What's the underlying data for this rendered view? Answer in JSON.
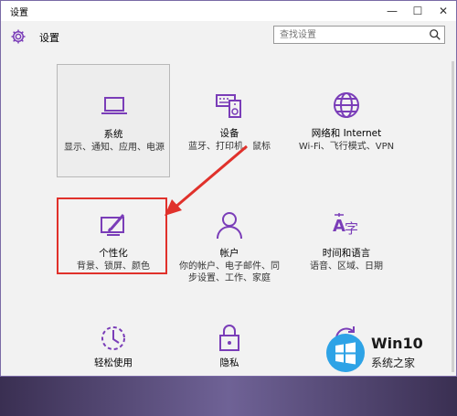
{
  "window": {
    "title": "设置"
  },
  "header": {
    "title": "设置"
  },
  "search": {
    "placeholder": "查找设置"
  },
  "tiles": [
    {
      "name": "系统",
      "desc": "显示、通知、应用、电源",
      "icon": "laptop-icon"
    },
    {
      "name": "设备",
      "desc": "蓝牙、打印机、鼠标",
      "icon": "keyboard-speaker-icon"
    },
    {
      "name": "网络和 Internet",
      "desc": "Wi-Fi、飞行模式、VPN",
      "icon": "globe-icon"
    },
    {
      "name": "个性化",
      "desc": "背景、锁屏、颜色",
      "icon": "paintbrush-display-icon"
    },
    {
      "name": "帐户",
      "desc": "你的帐户、电子邮件、同步设置、工作、家庭",
      "icon": "person-icon"
    },
    {
      "name": "时间和语言",
      "desc": "语音、区域、日期",
      "icon": "time-language-icon"
    },
    {
      "name": "轻松使用",
      "desc": "",
      "icon": "ease-of-access-icon"
    },
    {
      "name": "隐私",
      "desc": "",
      "icon": "lock-icon"
    },
    {
      "name": "",
      "desc": "",
      "icon": "update-icon"
    }
  ],
  "watermark": {
    "brand": "Win10",
    "site": "系统之家"
  },
  "colors": {
    "accent": "#7a3db8",
    "highlight": "#e0312b"
  }
}
